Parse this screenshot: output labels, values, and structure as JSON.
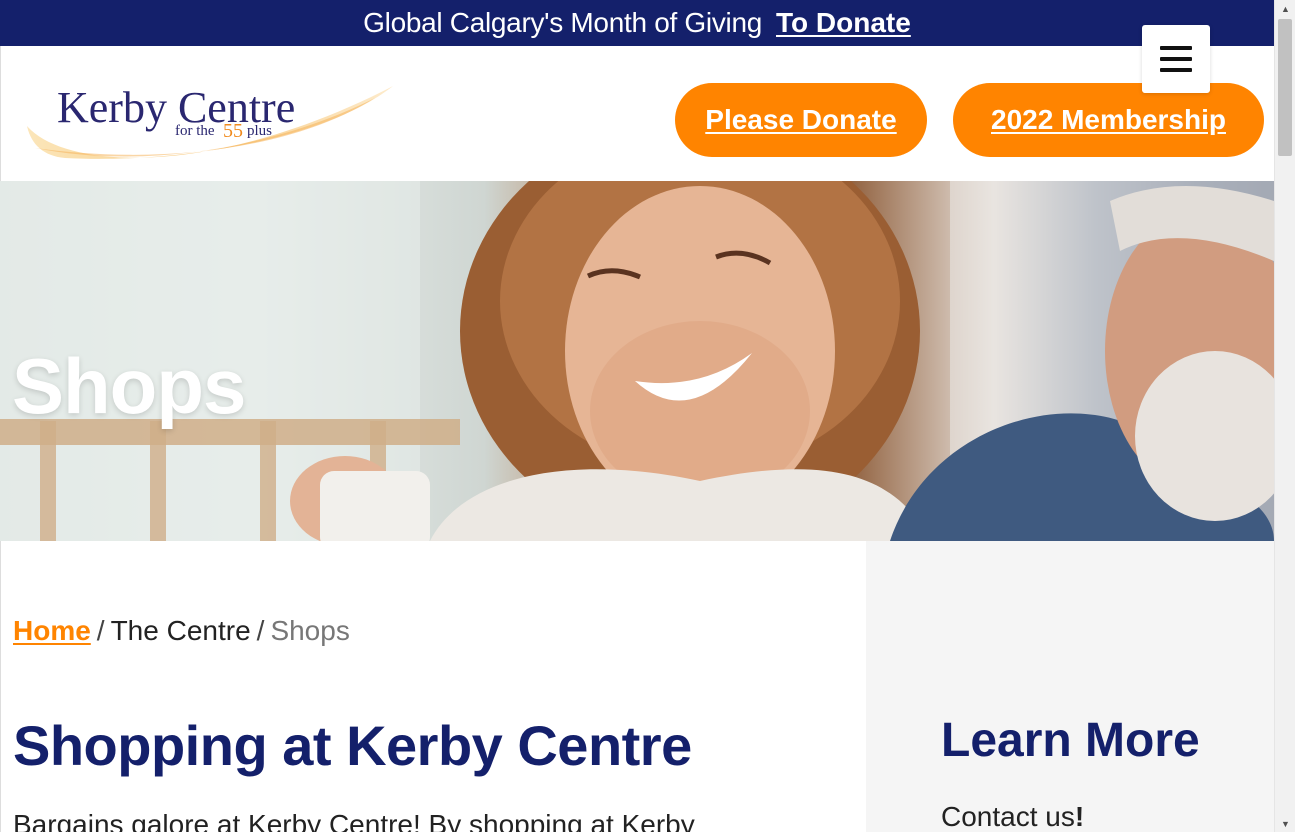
{
  "topbar": {
    "message": "Global Calgary's Month of Giving",
    "link_label": "To Donate"
  },
  "header": {
    "logo_name": "Kerby Centre",
    "logo_tagline_prefix": "for the",
    "logo_tagline_number": "55",
    "logo_tagline_suffix": "plus",
    "donate_button": "Please Donate",
    "membership_button": "2022 Membership"
  },
  "hero": {
    "title": "Shops"
  },
  "breadcrumb": {
    "home": "Home",
    "separator": "/",
    "section": "The Centre",
    "current": "Shops"
  },
  "content": {
    "heading": "Shopping at Kerby Centre",
    "intro": "Bargains galore at Kerby Centre! By shopping at Kerby"
  },
  "sidebar": {
    "heading": "Learn More",
    "contact_text": "Contact us",
    "contact_punct": "!"
  },
  "colors": {
    "navy": "#14206b",
    "orange": "#ff8400",
    "sidebar_bg": "#f5f5f5"
  },
  "icons": {
    "menu": "hamburger-menu-icon",
    "scroll_up": "scroll-up-arrow-icon",
    "scroll_down": "scroll-down-arrow-icon"
  }
}
